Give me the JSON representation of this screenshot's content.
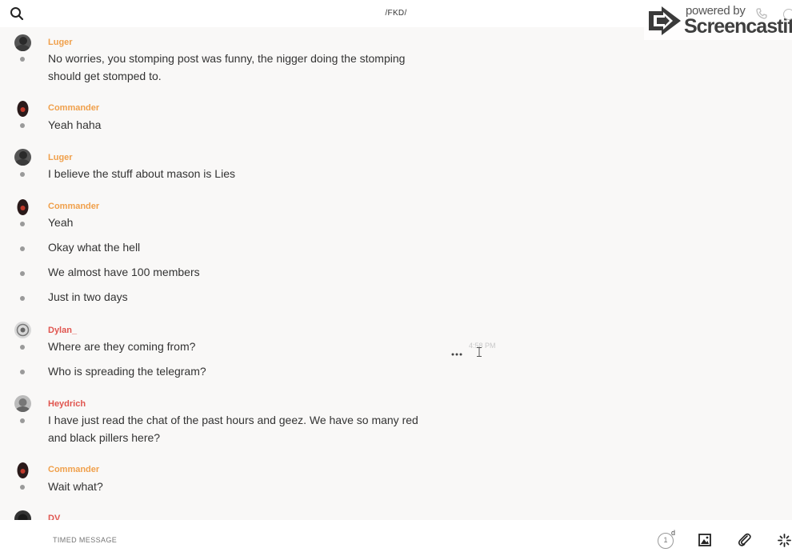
{
  "header": {
    "title": "/FKD/",
    "search_icon": "search-icon",
    "watermark": {
      "small": "powered by",
      "big": "Screencastify"
    }
  },
  "colors": {
    "author_orange": "#f0a04b",
    "author_red": "#e0554f",
    "dot": "#9a9a9a",
    "text": "#333333"
  },
  "messages": [
    {
      "author": "Luger",
      "author_color": "#f0a04b",
      "avatar": "dark",
      "lines": [
        "No worries, you stomping post was funny, the nigger doing the stomping should get stomped to."
      ]
    },
    {
      "author": "Commander",
      "author_color": "#f0a04b",
      "avatar": "red",
      "lines": [
        "Yeah haha"
      ]
    },
    {
      "author": "Luger",
      "author_color": "#f0a04b",
      "avatar": "dark",
      "lines": [
        "I believe the stuff about mason is Lies"
      ]
    },
    {
      "author": "Commander",
      "author_color": "#f0a04b",
      "avatar": "red",
      "lines": [
        "Yeah",
        "Okay what the hell",
        "We almost have 100 members",
        "Just in two days"
      ]
    },
    {
      "author": "Dylan_",
      "author_color": "#e0554f",
      "avatar": "light",
      "lines": [
        "Where are they coming from?",
        "Who is spreading the telegram?"
      ]
    },
    {
      "author": "Heydrich",
      "author_color": "#e0554f",
      "avatar": "gray",
      "lines": [
        "I have just read the chat of the past hours and geez. We have so many red and black pillers here?"
      ]
    },
    {
      "author": "Commander",
      "author_color": "#f0a04b",
      "avatar": "red",
      "lines": [
        "Wait what?"
      ]
    },
    {
      "author": "DV",
      "author_color": "#e0554f",
      "avatar": "dark",
      "lines": []
    }
  ],
  "hover": {
    "more_label": "•••",
    "timestamp": "4:58 PM"
  },
  "composer": {
    "placeholder": "TIMED MESSAGE",
    "timer_value": "1",
    "timer_unit": "d"
  }
}
